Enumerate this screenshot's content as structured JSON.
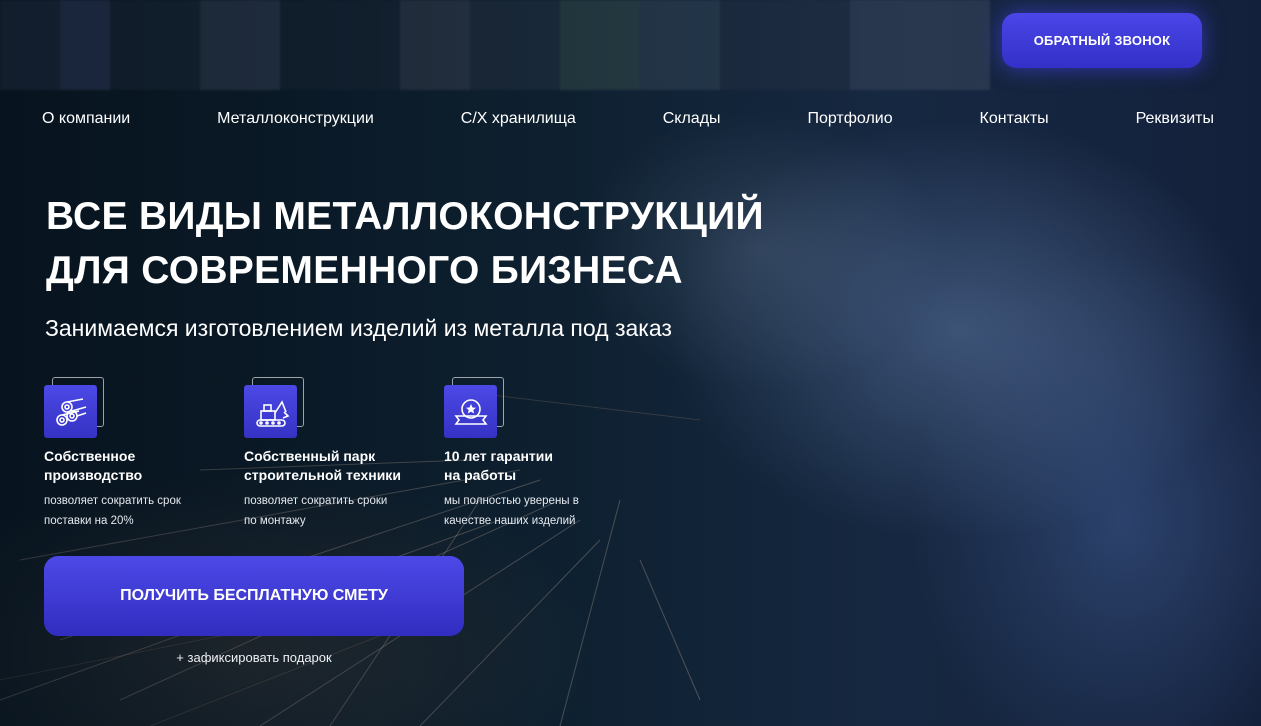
{
  "header": {
    "callback_label": "ОБРАТНЫЙ ЗВОНОК"
  },
  "nav": {
    "items": [
      {
        "label": "О компании"
      },
      {
        "label": "Металлоконструкции"
      },
      {
        "label": "С/Х хранилища"
      },
      {
        "label": "Склады"
      },
      {
        "label": "Портфолио"
      },
      {
        "label": "Контакты"
      },
      {
        "label": "Реквизиты"
      }
    ]
  },
  "hero": {
    "title_line1": "ВСЕ ВИДЫ МЕТАЛЛОКОНСТРУКЦИЙ",
    "title_line2": "ДЛЯ СОВРЕМЕННОГО БИЗНЕСА",
    "subtitle": "Занимаемся изготовлением изделий из металла под заказ"
  },
  "features": [
    {
      "icon": "pipes-icon",
      "title_line1": "Собственное",
      "title_line2": "производство",
      "desc_line1": "позволяет сократить срок",
      "desc_line2": "поставки на 20%"
    },
    {
      "icon": "excavator-icon",
      "title_line1": "Собственный парк",
      "title_line2": "строительной техники",
      "desc_line1": "позволяет сократить сроки",
      "desc_line2": "по монтажу"
    },
    {
      "icon": "award-ribbon-icon",
      "title_line1": "10 лет гарантии",
      "title_line2": "на работы",
      "desc_line1": "мы полностью уверены в",
      "desc_line2": "качестве наших изделий"
    }
  ],
  "cta": {
    "button_label": "ПОЛУЧИТЬ БЕСПЛАТНУЮ СМЕТУ",
    "note": "+ зафиксировать подарок"
  },
  "colors": {
    "accent": "#3f3cd9",
    "text": "#ffffff"
  }
}
